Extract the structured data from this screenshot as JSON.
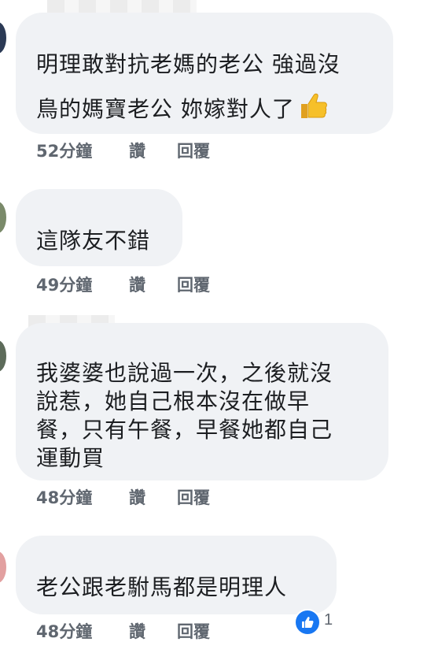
{
  "comments": [
    {
      "lines": [
        "明理敢對抗老媽的老公 強過沒",
        "鳥的媽寶老公 妳嫁對人了"
      ],
      "has_thumbs_emoji": true,
      "time": "52分鐘",
      "like_label": "讚",
      "reply_label": "回覆"
    },
    {
      "lines": [
        "這隊友不錯"
      ],
      "time": "49分鐘",
      "like_label": "讚",
      "reply_label": "回覆"
    },
    {
      "lines": [
        "我婆婆也說過一次，之後就沒",
        "說惹，她自己根本沒在做早",
        "餐，只有午餐，早餐她都自己",
        "運動買"
      ],
      "time": "48分鐘",
      "like_label": "讚",
      "reply_label": "回覆"
    },
    {
      "lines": [
        "老公跟老駙馬都是明理人"
      ],
      "time": "48分鐘",
      "like_label": "讚",
      "reply_label": "回覆",
      "reaction": {
        "icon": "like-icon",
        "count": "1"
      }
    }
  ],
  "colors": {
    "bubble": "#f0f2f5",
    "text": "#1c1e21",
    "meta": "#606770",
    "reaction": "#1877f2"
  }
}
